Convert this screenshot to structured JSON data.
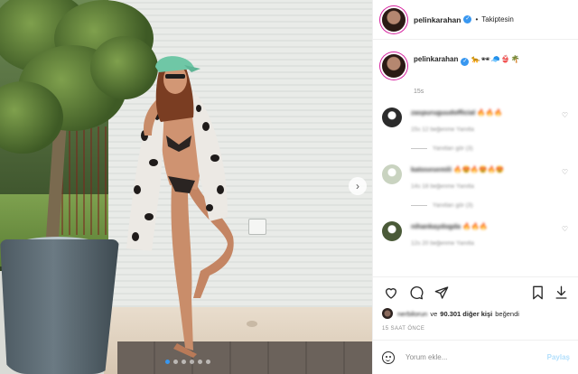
{
  "post": {
    "username": "pelinkarahan",
    "verified_glyph": "✓",
    "follow_sep": "•",
    "follow_status": "Takiptesin"
  },
  "caption": {
    "username": "pelinkarahan",
    "emojis": "🐆🕶🧢👙🌴",
    "time": "15s"
  },
  "comments": [
    {
      "user": "zaspuruguudofficial",
      "text": "🔥🔥🔥",
      "meta": "15s   12 beğenme   Yanıtla",
      "replies": "Yanıtları gör (3)",
      "avatar_color": "#2b2b2b"
    },
    {
      "user": "katosesemili",
      "text": "🔥😍🔥😍🔥😍",
      "meta": "14s   18 beğenme   Yanıtla",
      "replies": "Yanıtları gör (3)",
      "avatar_color": "#c9d3c0"
    },
    {
      "user": "nihankaydogda",
      "text": "🔥🔥🔥",
      "meta": "12s   20 beğenme   Yanıtla",
      "replies": "",
      "avatar_color": "#4a5a38"
    }
  ],
  "likes": {
    "liker": "nerbilorun",
    "connector": "ve",
    "count": "90.301 diğer kişi",
    "suffix": "beğendi"
  },
  "time_ago": "15 SAAT ÖNCE",
  "comment_input": {
    "placeholder": "Yorum ekle..."
  },
  "post_button": "Paylaş",
  "carousel": {
    "slides": 6,
    "active": 0
  },
  "icons": {
    "heart": "heart-icon",
    "comment": "comment-icon",
    "share": "share-icon",
    "save": "bookmark-icon",
    "download": "download-icon",
    "next": "chevron-right-icon",
    "emoji": "smiley-icon"
  },
  "colors": {
    "accent": "#3897f0",
    "muted": "#8e8e8e",
    "post_button": "#b2dffc"
  }
}
